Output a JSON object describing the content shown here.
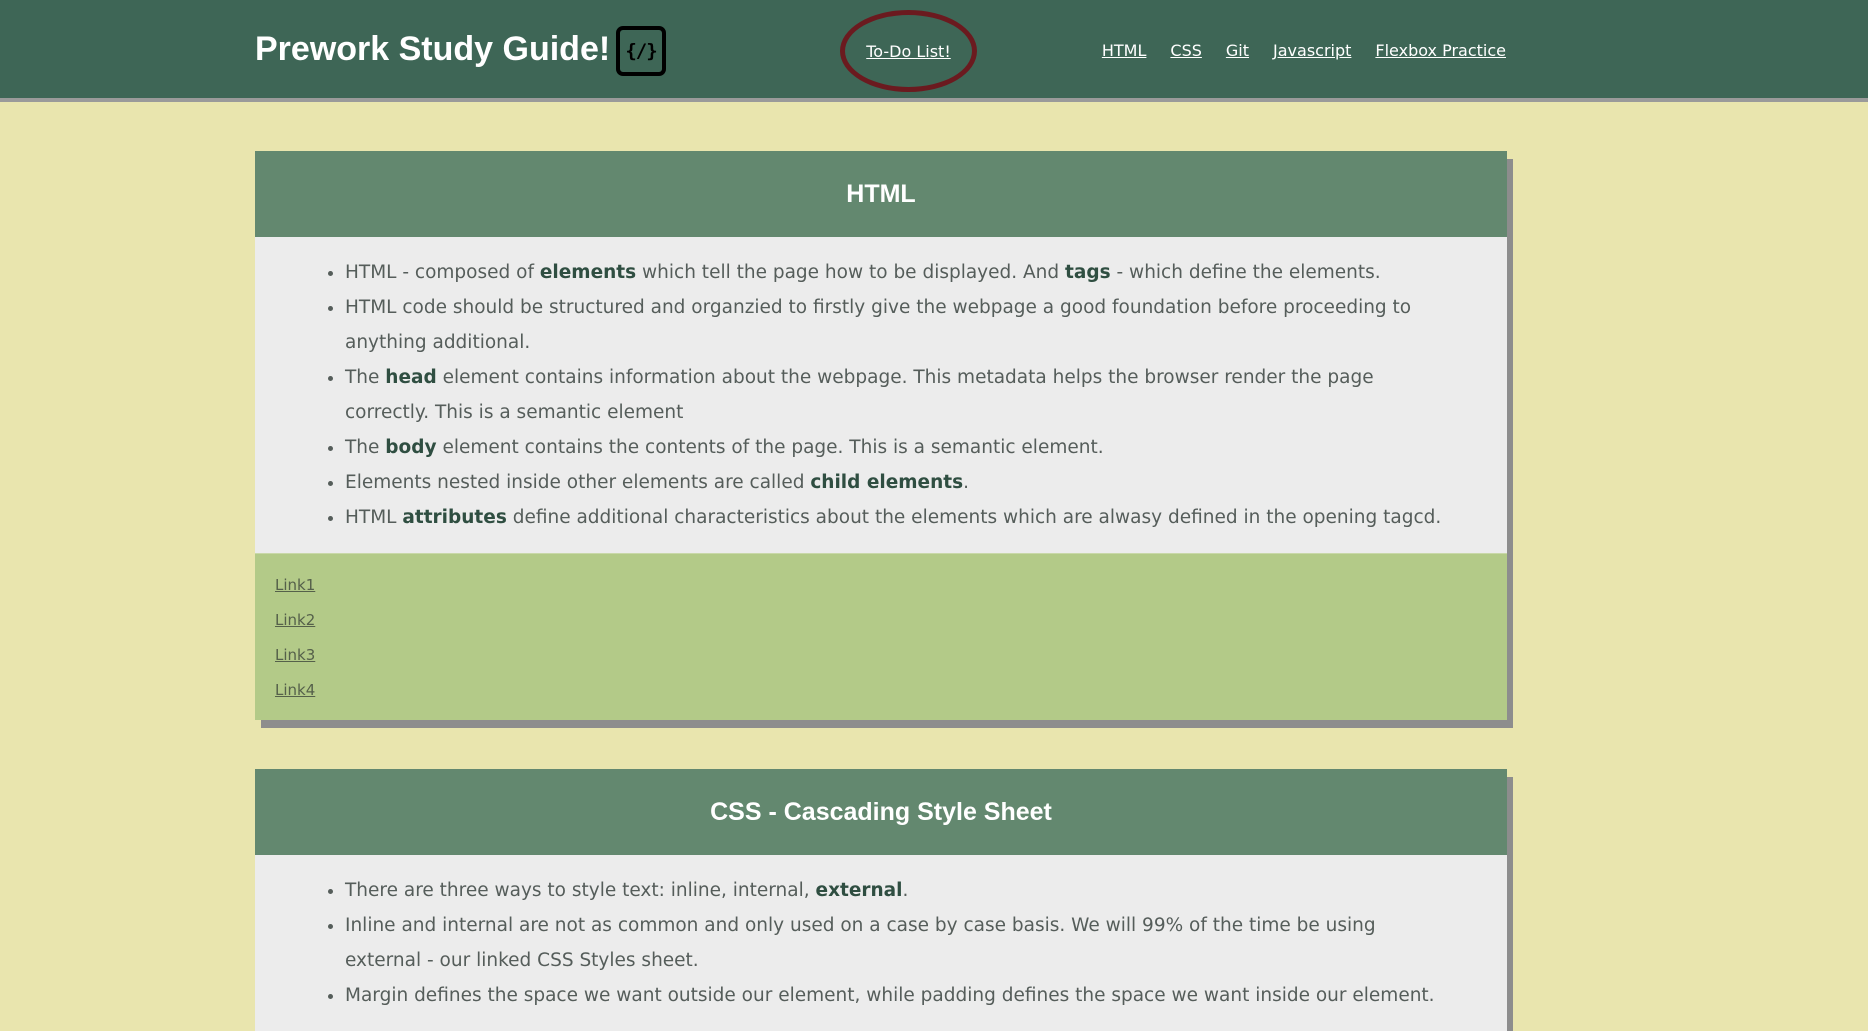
{
  "header": {
    "title": "Prework Study Guide!",
    "logo_text": "{/}",
    "todo_link": "To-Do List!",
    "nav": [
      "HTML",
      "CSS",
      "Git",
      "Javascript",
      "Flexbox Practice"
    ]
  },
  "sections": [
    {
      "title": "HTML",
      "items": [
        [
          {
            "t": "HTML - composed of "
          },
          {
            "t": "elements",
            "b": true
          },
          {
            "t": " which tell the page how to be displayed. And "
          },
          {
            "t": "tags",
            "b": true
          },
          {
            "t": " - which define the elements."
          }
        ],
        [
          {
            "t": "HTML code should be structured and organzied to firstly give the webpage a good foundation before proceeding to anything additional."
          }
        ],
        [
          {
            "t": "The "
          },
          {
            "t": "head",
            "b": true
          },
          {
            "t": " element contains information about the webpage. This metadata helps the browser render the page correctly. This is a semantic element"
          }
        ],
        [
          {
            "t": "The "
          },
          {
            "t": "body",
            "b": true
          },
          {
            "t": " element contains the contents of the page. This is a semantic element."
          }
        ],
        [
          {
            "t": "Elements nested inside other elements are called "
          },
          {
            "t": "child elements",
            "b": true
          },
          {
            "t": "."
          }
        ],
        [
          {
            "t": "HTML "
          },
          {
            "t": "attributes",
            "b": true
          },
          {
            "t": " define additional characteristics about the elements which are alwasy defined in the opening tagcd."
          }
        ]
      ],
      "links": [
        "Link1",
        "Link2",
        "Link3",
        "Link4"
      ]
    },
    {
      "title": "CSS - Cascading Style Sheet",
      "items": [
        [
          {
            "t": "There are three ways to style text: inline, internal, "
          },
          {
            "t": "external",
            "b": true
          },
          {
            "t": "."
          }
        ],
        [
          {
            "t": "Inline and internal are not as common and only used on a case by case basis. We will 99% of the time be using external - our linked CSS Styles sheet."
          }
        ],
        [
          {
            "t": "Margin defines the space we want outside our element, while padding defines the space we want inside our element."
          }
        ]
      ],
      "links": []
    }
  ],
  "colors": {
    "page_bg": "#e9e5ae",
    "header_bg": "#3e6656",
    "card_header_bg": "#63886f",
    "card_body_bg": "#ececec",
    "card_footer_bg": "#b3ca88",
    "todo_circle": "#6b1a1f"
  }
}
